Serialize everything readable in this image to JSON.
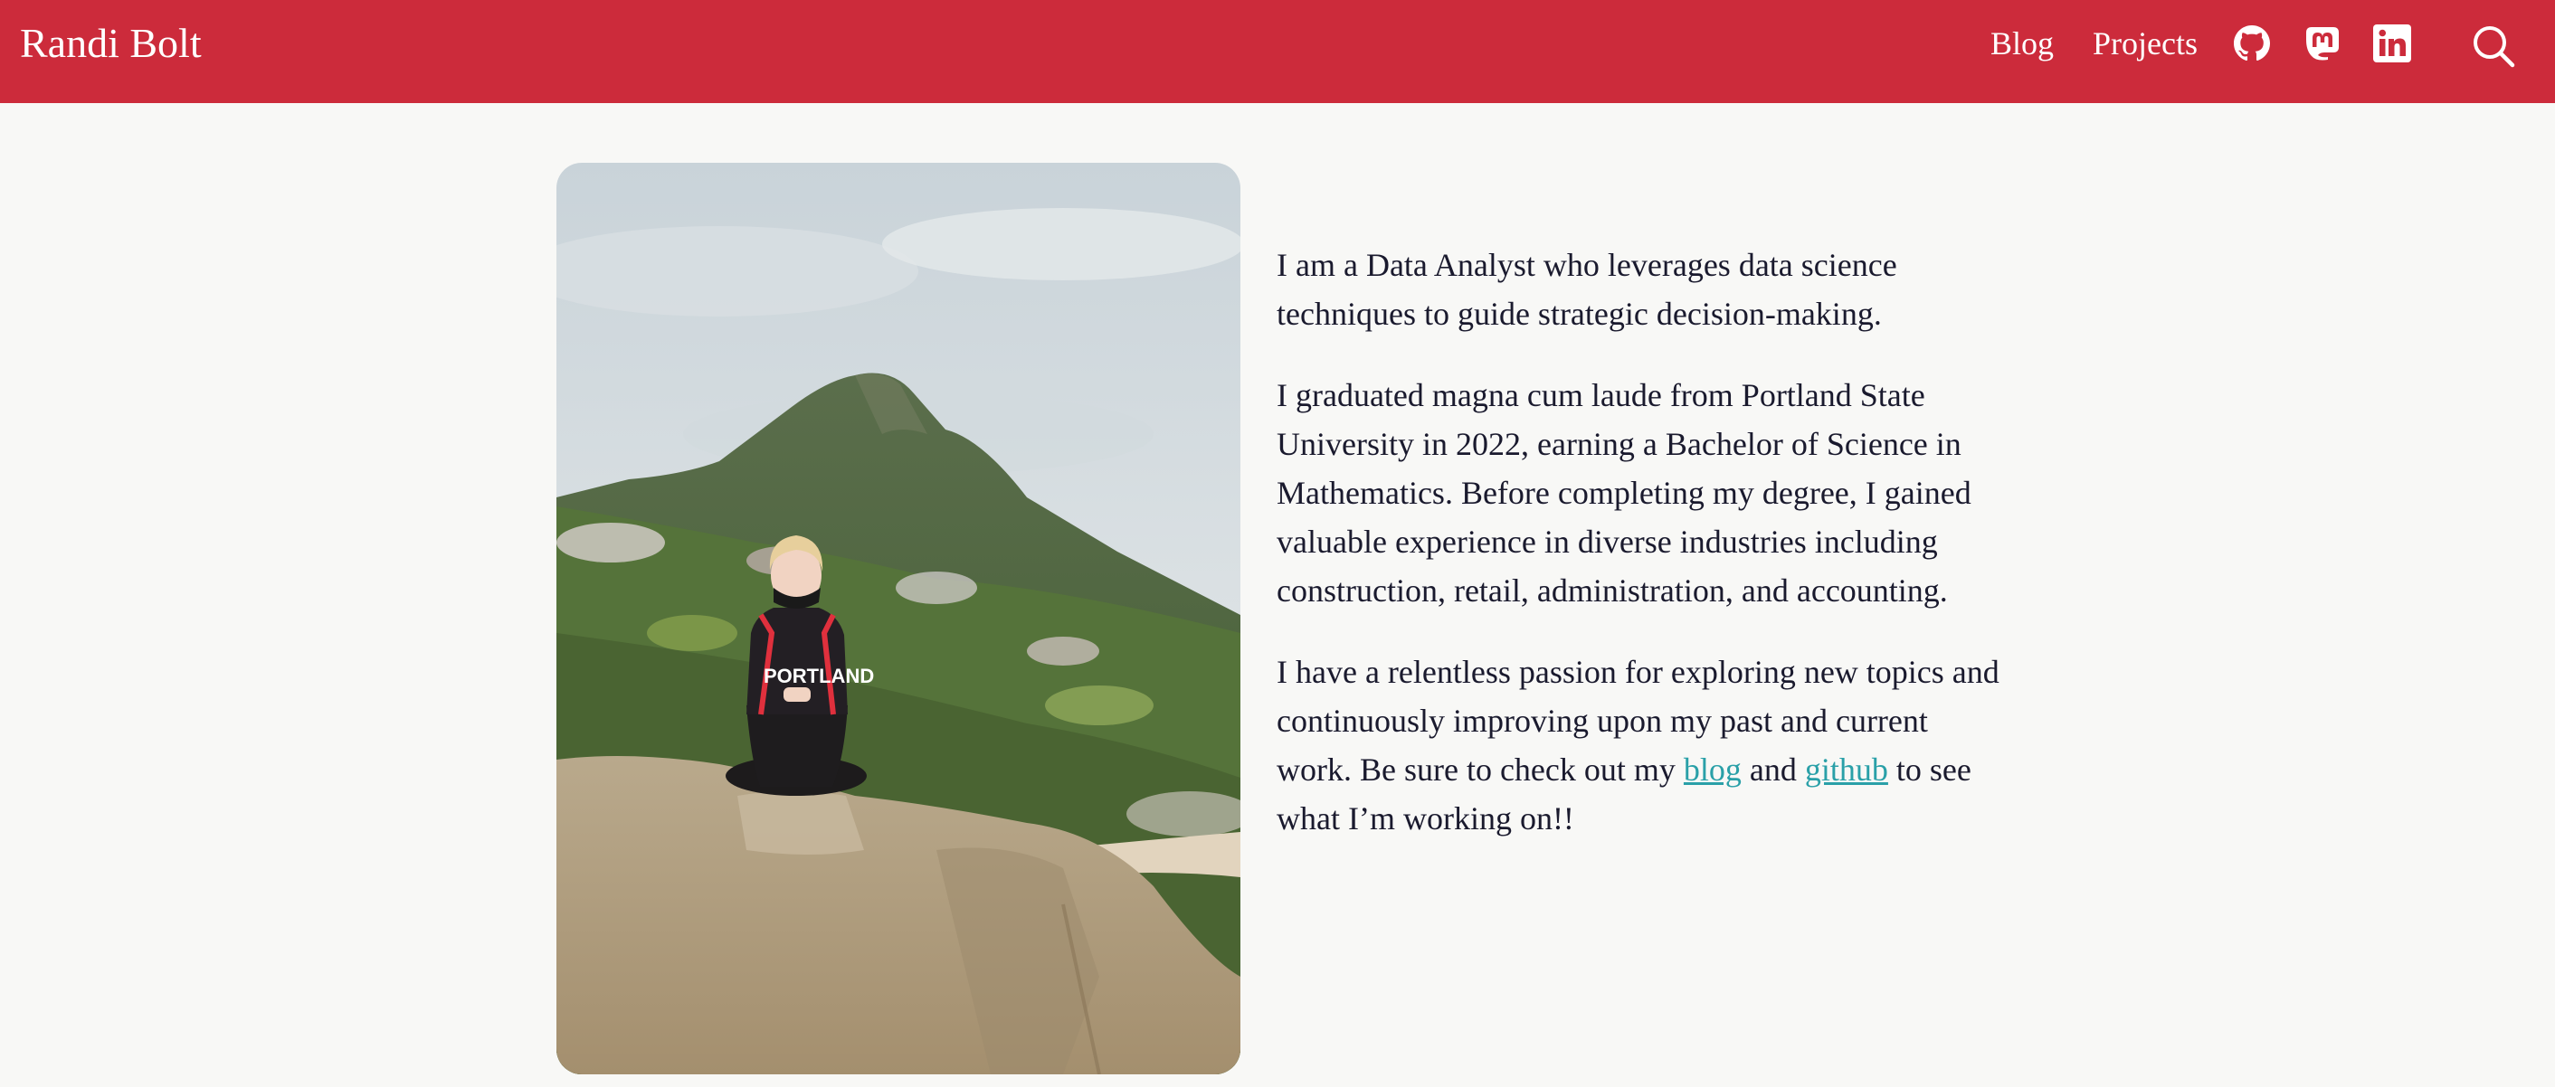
{
  "header": {
    "brand": "Randi Bolt",
    "nav": {
      "blog_label": "Blog",
      "projects_label": "Projects"
    },
    "icons": [
      "github-icon",
      "mastodon-icon",
      "linkedin-icon",
      "search-icon"
    ]
  },
  "colors": {
    "navbar": "#cc2b3b",
    "page_background": "#f8f8f6",
    "link": "#2aa0a8",
    "text": "#1a1a2e"
  },
  "about": {
    "p1": "I am a Data Analyst who leverages data science techniques to guide strategic decision-making.",
    "p2": "I graduated magna cum laude from Portland State University in 2022, earning a Bachelor of Science in Mathematics. Before completing my degree, I gained valuable experience in diverse industries including construction, retail, administration, and accounting.",
    "p3_before": "I have a relentless passion for exploring new topics and continuously improving upon my past and current work. Be sure to check out my ",
    "p3_link1": "blog",
    "p3_between": " and ",
    "p3_link2": "github",
    "p3_after": " to see what I’m working on!!"
  },
  "photo": {
    "jersey_text": "PORTLAND"
  }
}
